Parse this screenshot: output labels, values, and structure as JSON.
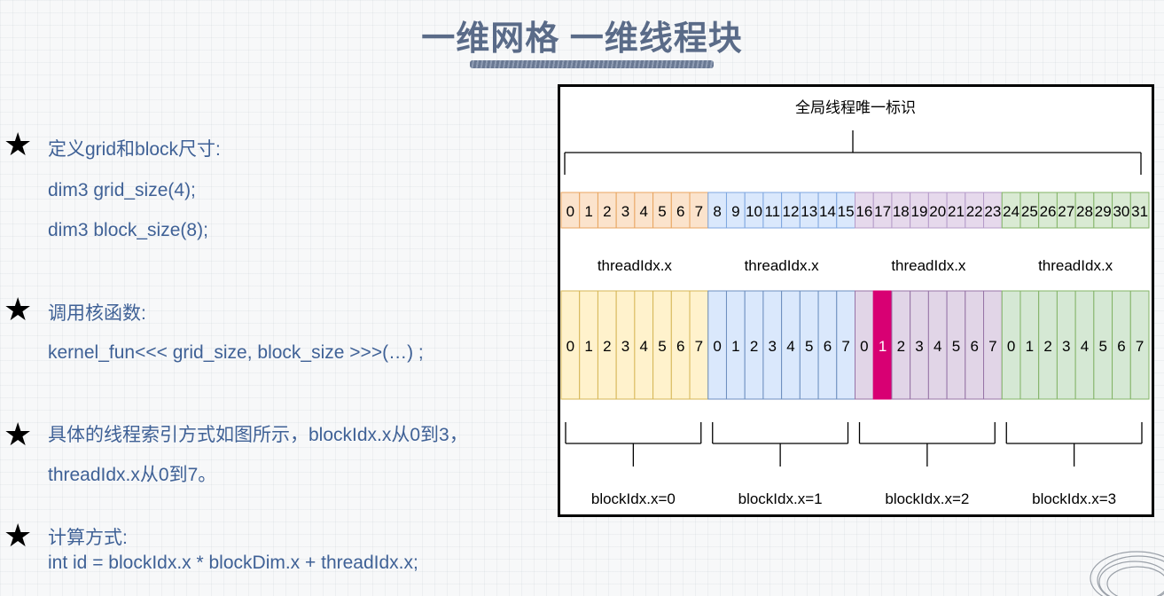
{
  "title": "一维网格 一维线程块",
  "sections": [
    {
      "heading": "定义grid和block尺寸:",
      "lines": [
        "dim3 grid_size(4);",
        "dim3 block_size(8);"
      ]
    },
    {
      "heading": "调用核函数:",
      "lines": [
        "kernel_fun<<< grid_size, block_size >>>(…) ;"
      ]
    },
    {
      "heading": "具体的线程索引方式如图所示，blockIdx.x从0到3，",
      "lines": [
        "threadIdx.x从0到7。"
      ]
    },
    {
      "heading": "计算方式:",
      "lines": [
        "int id = blockIdx.x * blockDim.x + threadIdx.x;"
      ]
    }
  ],
  "diagram": {
    "top_label": "全局线程唯一标识",
    "global_ids": [
      "0",
      "1",
      "2",
      "3",
      "4",
      "5",
      "6",
      "7",
      "8",
      "9",
      "10",
      "11",
      "12",
      "13",
      "14",
      "15",
      "16",
      "17",
      "18",
      "19",
      "20",
      "21",
      "22",
      "23",
      "24",
      "25",
      "26",
      "27",
      "28",
      "29",
      "30",
      "31"
    ],
    "thread_label": "threadIdx.x",
    "local_ids": [
      "0",
      "1",
      "2",
      "3",
      "4",
      "5",
      "6",
      "7"
    ],
    "block_labels": [
      "blockIdx.x=0",
      "blockIdx.x=1",
      "blockIdx.x=2",
      "blockIdx.x=3"
    ],
    "highlight": {
      "block": 2,
      "thread": 1
    },
    "colors": {
      "block_fill_top": [
        "#fbe3cc",
        "#dae8fc",
        "#e6d9ec",
        "#d9ead3"
      ],
      "block_stroke_top": [
        "#e8a45f",
        "#7ea6e0",
        "#b59bc9",
        "#82b366"
      ],
      "block_fill_bottom": [
        "#fff2cc",
        "#dae8fc",
        "#e1d5e7",
        "#d5e8d4"
      ],
      "block_stroke_bottom": [
        "#d6b656",
        "#6c8ebf",
        "#9673a6",
        "#82b366"
      ],
      "highlight_fill": "#d80073",
      "text": "#5a6b88",
      "accent": "#3f6196"
    }
  }
}
